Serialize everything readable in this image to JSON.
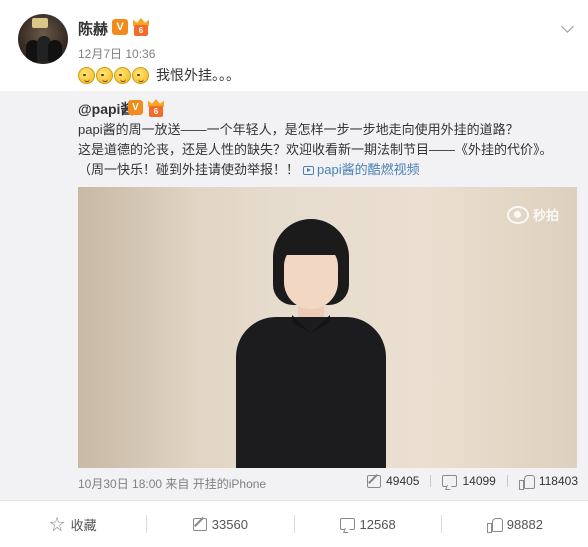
{
  "post": {
    "author": "陈赫",
    "verified_badge": "V",
    "vip_level": "6",
    "timestamp": "12月7日 10:36",
    "emoji_count": 4,
    "emoji_icon": "dizzy-face-emoji",
    "status_text": "我恨外挂。。。"
  },
  "repost": {
    "author": "@papi酱",
    "verified_badge": "V",
    "vip_level": "6",
    "text_line_1": "papi酱的周一放送——一个年轻人，是怎样一步一步地走向使用外挂的道路？",
    "text_line_2": "这是道德的沦丧，还是人性的缺失？欢迎收看新一期法制节目——《外挂的代价》。",
    "text_line_3": "（周一快乐！碰到外挂请使劲举报！！",
    "video_link": "papi酱的酷燃视频",
    "video_watermark": "秒拍",
    "meta": "10月30日 18:00 来自 开挂的iPhone",
    "reposts": "49405",
    "comments": "14099",
    "likes": "118403"
  },
  "actions": {
    "favorite": "收藏",
    "repost": "33560",
    "comment": "12568",
    "like": "98882"
  },
  "colors": {
    "link": "#4a7fb5",
    "badge_orange": "#f28a1c",
    "repost_bg": "#f2f2f5"
  }
}
